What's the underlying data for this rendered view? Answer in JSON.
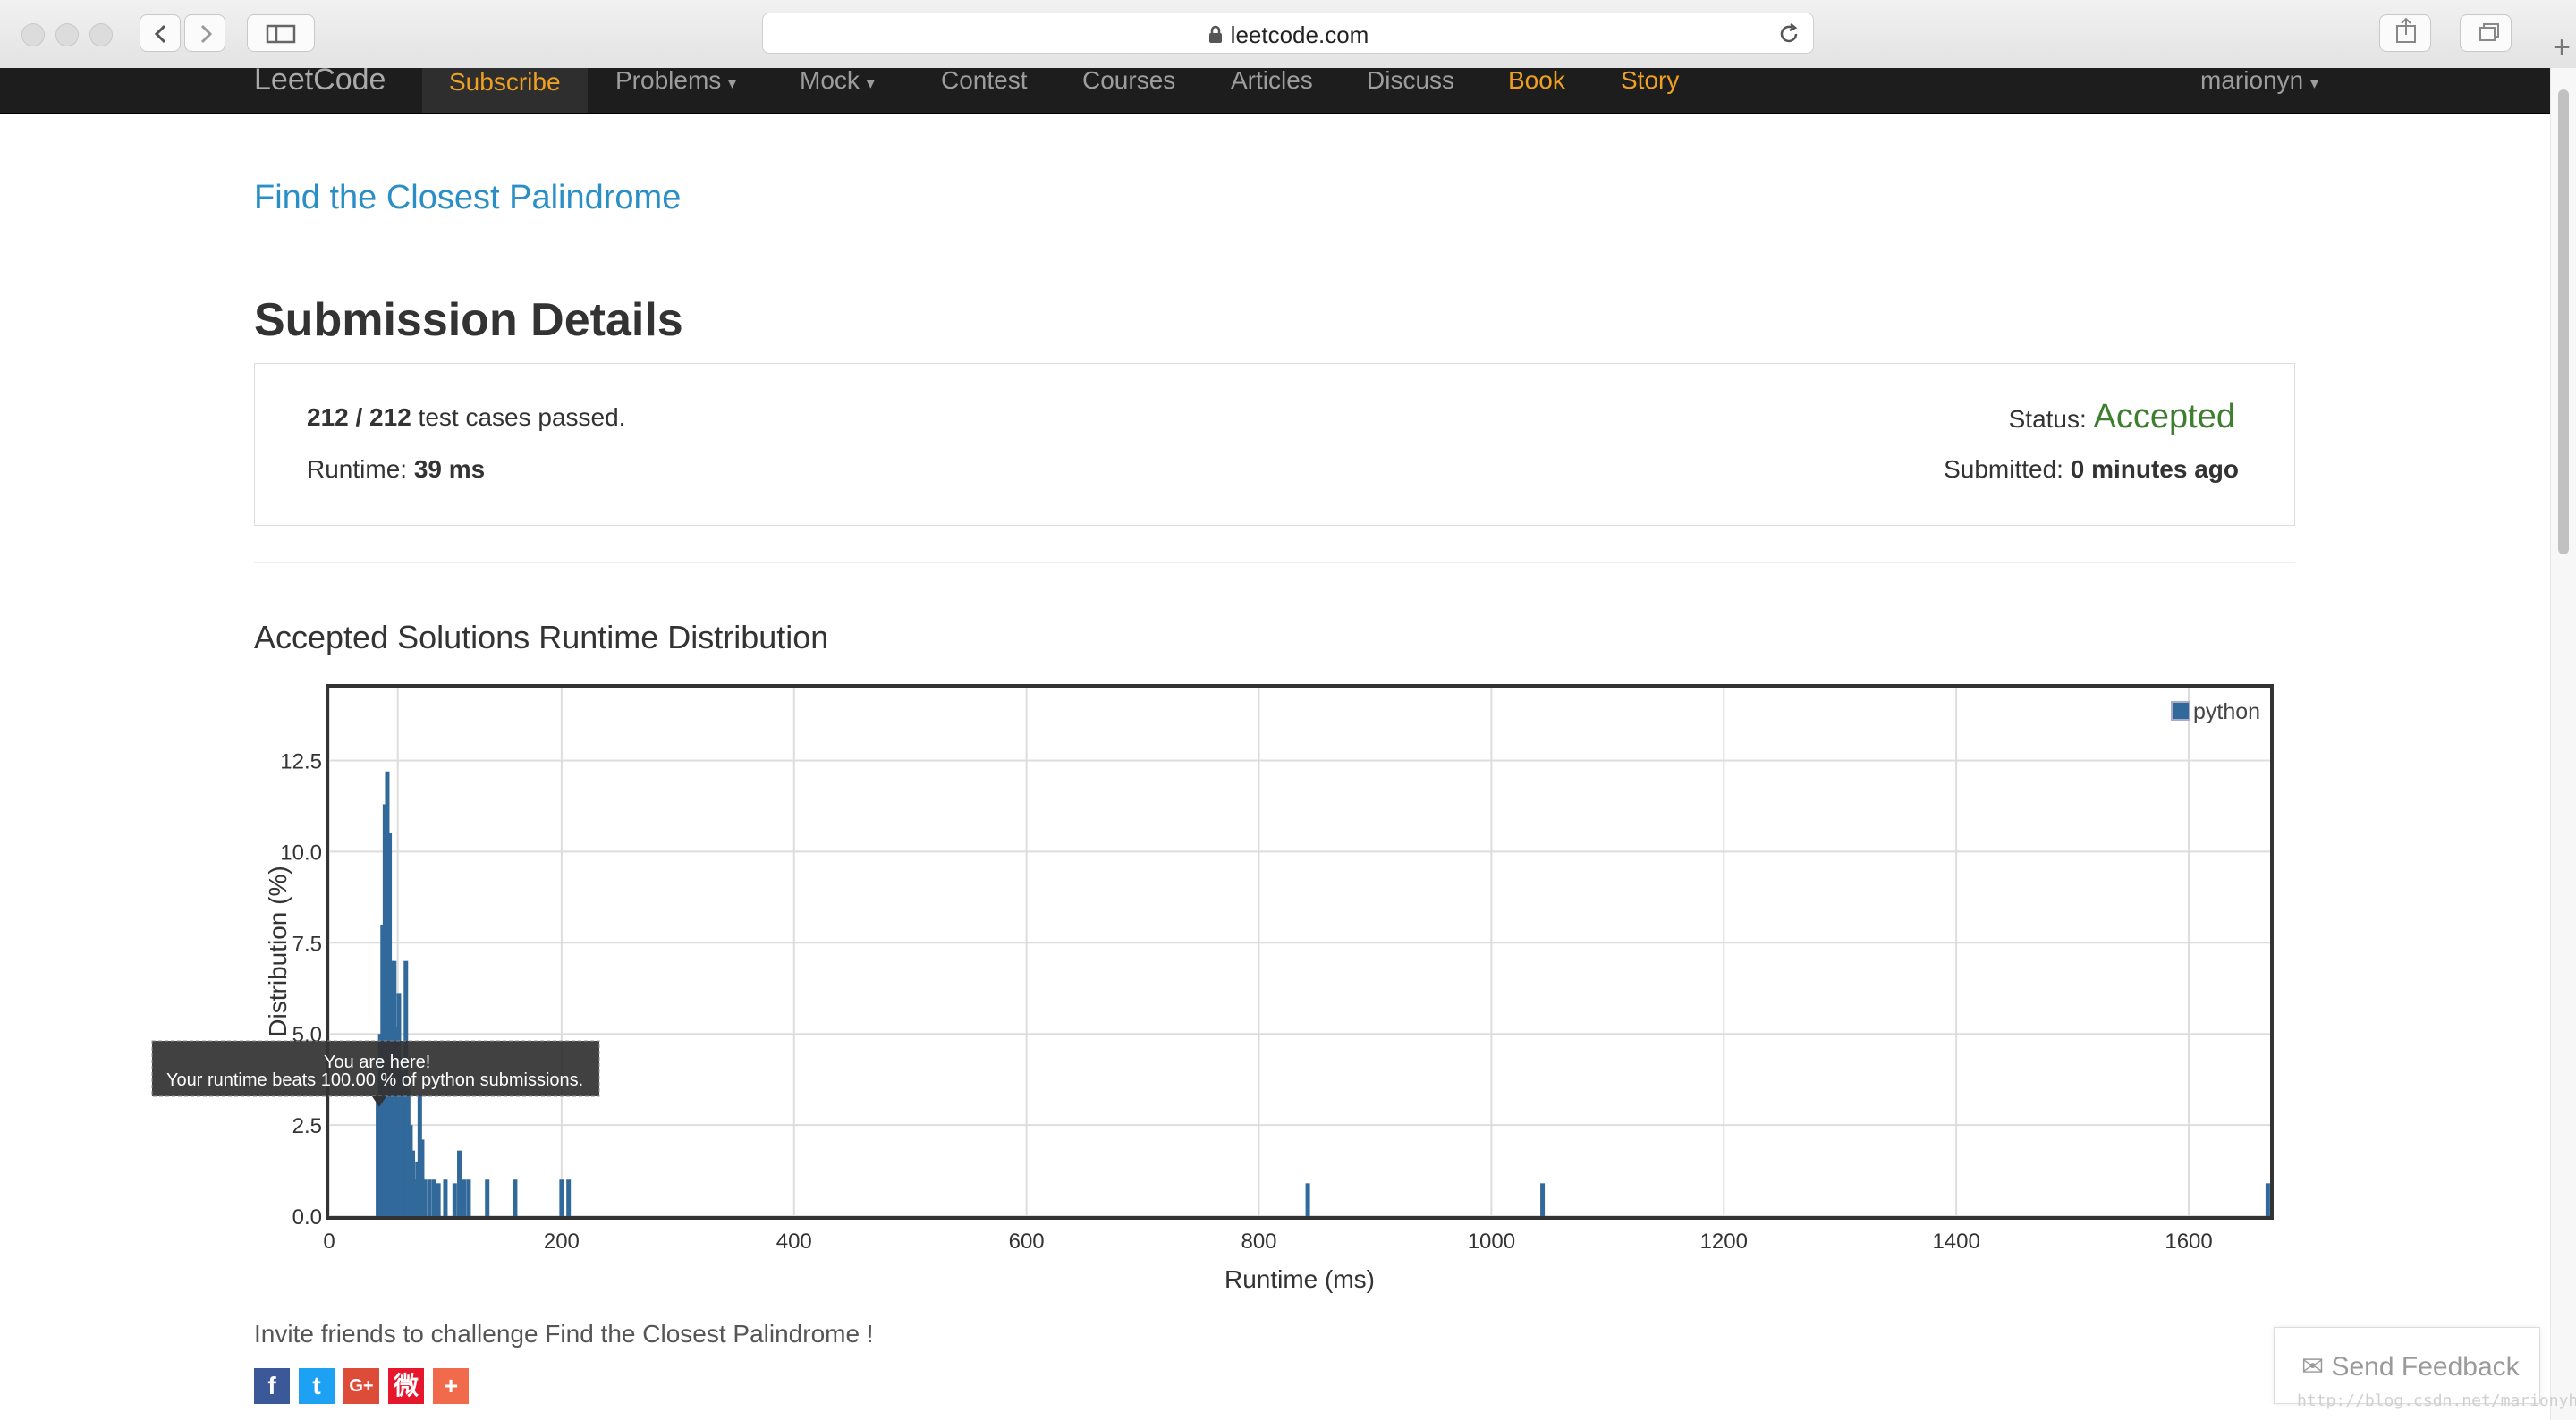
{
  "browser": {
    "url": "leetcode.com",
    "icons": [
      "back-icon",
      "forward-icon",
      "sidebar-icon",
      "lock-icon",
      "reload-icon",
      "share-icon",
      "tabs-icon",
      "new-tab-icon"
    ],
    "new_tab_symbol": "+"
  },
  "nav": {
    "logo": "LeetCode",
    "items": [
      "Subscribe",
      "Problems",
      "Mock",
      "Contest",
      "Courses",
      "Articles",
      "Discuss",
      "Book",
      "Story"
    ],
    "user": "marionyn",
    "caret": "▾",
    "colors": {
      "bg": "#1d1d1d",
      "highlight": "#f0a020"
    }
  },
  "problem_title": "Find the Closest Palindrome",
  "submission": {
    "heading": "Submission Details",
    "passed": "212 / 212",
    "passed_suffix": " test cases passed.",
    "runtime_label": "Runtime: ",
    "runtime_value": "39 ms",
    "status_label": "Status: ",
    "status_value": "Accepted",
    "submitted_label": "Submitted: ",
    "submitted_value": "0 minutes ago",
    "status_color": "#3d7f2f"
  },
  "distribution": {
    "heading": "Accepted Solutions Runtime Distribution"
  },
  "tooltip": {
    "line1": "You are here!",
    "line2": "Your runtime beats 100.00 % of python submissions."
  },
  "chart_data": {
    "type": "bar",
    "xlabel": "Runtime (ms)",
    "ylabel": "Distribution (%)",
    "xlim": [
      0,
      1670
    ],
    "ylim": [
      0,
      14.5
    ],
    "xticks": [
      0,
      200,
      400,
      600,
      800,
      1000,
      1200,
      1400,
      1600
    ],
    "yticks": [
      0.0,
      2.5,
      5.0,
      7.5,
      10.0,
      12.5
    ],
    "grid": true,
    "legend_position": "top-right",
    "series": [
      {
        "name": "python",
        "color": "#31699b",
        "x": [
          42,
          44,
          46,
          48,
          50,
          52,
          54,
          56,
          58,
          60,
          62,
          64,
          66,
          68,
          70,
          72,
          74,
          76,
          78,
          80,
          82,
          86,
          90,
          94,
          100,
          108,
          112,
          116,
          120,
          136,
          160,
          200,
          206,
          842,
          1044,
          1668
        ],
        "values": [
          3.2,
          5.0,
          8.0,
          11.3,
          12.2,
          10.5,
          7.0,
          7.0,
          5.2,
          6.1,
          4.0,
          3.5,
          7.0,
          3.5,
          2.5,
          1.8,
          1.0,
          1.5,
          3.3,
          2.1,
          1.0,
          1.0,
          1.0,
          0.9,
          1.0,
          0.9,
          1.8,
          1.0,
          1.0,
          1.0,
          1.0,
          1.0,
          1.0,
          0.9,
          0.9,
          0.9
        ]
      }
    ],
    "marker_x": 39
  },
  "invite_text": "Invite friends to challenge Find the Closest Palindrome !",
  "share_icons": [
    {
      "name": "facebook-icon",
      "glyph": "f",
      "color": "#3b5998"
    },
    {
      "name": "twitter-icon",
      "glyph": "t",
      "color": "#1da1f2"
    },
    {
      "name": "google-plus-icon",
      "glyph": "G+",
      "color": "#dd4b39"
    },
    {
      "name": "weibo-icon",
      "glyph": "微",
      "color": "#e6162d"
    },
    {
      "name": "more-share-icon",
      "glyph": "+",
      "color": "#f06a4b"
    }
  ],
  "feedback": {
    "label": "Send Feedback",
    "icon": "mail-icon"
  },
  "watermark": "http://blog.csdn.net/marionyh"
}
